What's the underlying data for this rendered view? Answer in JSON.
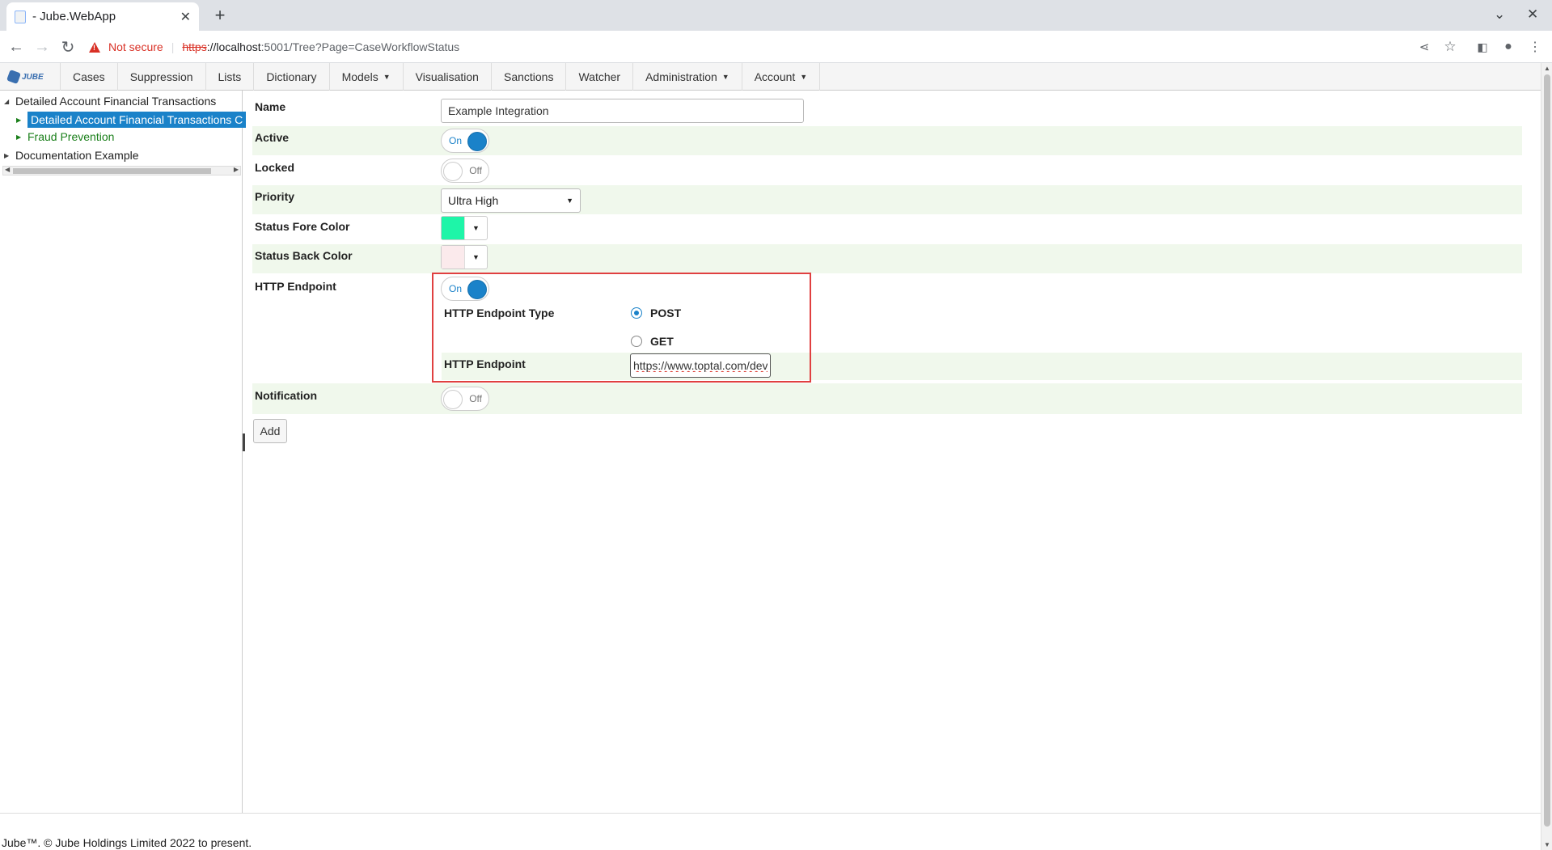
{
  "browser": {
    "tab_title": "- Jube.WebApp",
    "security_label": "Not secure",
    "url_scheme": "https",
    "url_host": "://localhost",
    "url_rest": ":5001/Tree?Page=CaseWorkflowStatus"
  },
  "app": {
    "logo_text": "JUBE",
    "nav": [
      {
        "label": "Cases"
      },
      {
        "label": "Suppression"
      },
      {
        "label": "Lists"
      },
      {
        "label": "Dictionary"
      },
      {
        "label": "Models"
      },
      {
        "label": "Visualisation"
      },
      {
        "label": "Sanctions"
      },
      {
        "label": "Watcher"
      },
      {
        "label": "Administration"
      },
      {
        "label": "Account"
      }
    ]
  },
  "tree": {
    "nodes": [
      {
        "label": "Detailed Account Financial Transactions"
      },
      {
        "label": "Detailed Account Financial Transactions C"
      },
      {
        "label": "Fraud Prevention"
      },
      {
        "label": "Documentation Example"
      }
    ]
  },
  "form": {
    "name": {
      "label": "Name",
      "value": "Example Integration"
    },
    "active": {
      "label": "Active",
      "state": "On"
    },
    "locked": {
      "label": "Locked",
      "state": "Off"
    },
    "priority": {
      "label": "Priority",
      "value": "Ultra High"
    },
    "status_fore_color": {
      "label": "Status Fore Color",
      "color": "#1ef5a8"
    },
    "status_back_color": {
      "label": "Status Back Color",
      "color": "#fbeaec"
    },
    "http_endpoint": {
      "label": "HTTP Endpoint",
      "state": "On",
      "type_label": "HTTP Endpoint Type",
      "options": [
        "POST",
        "GET"
      ],
      "selected": "POST",
      "endpoint_label": "HTTP Endpoint",
      "endpoint_value": "https://www.toptal.com/deve"
    },
    "notification": {
      "label": "Notification",
      "state": "Off"
    },
    "add_button": "Add"
  },
  "footer": "Jube™. © Jube Holdings Limited 2022 to present."
}
